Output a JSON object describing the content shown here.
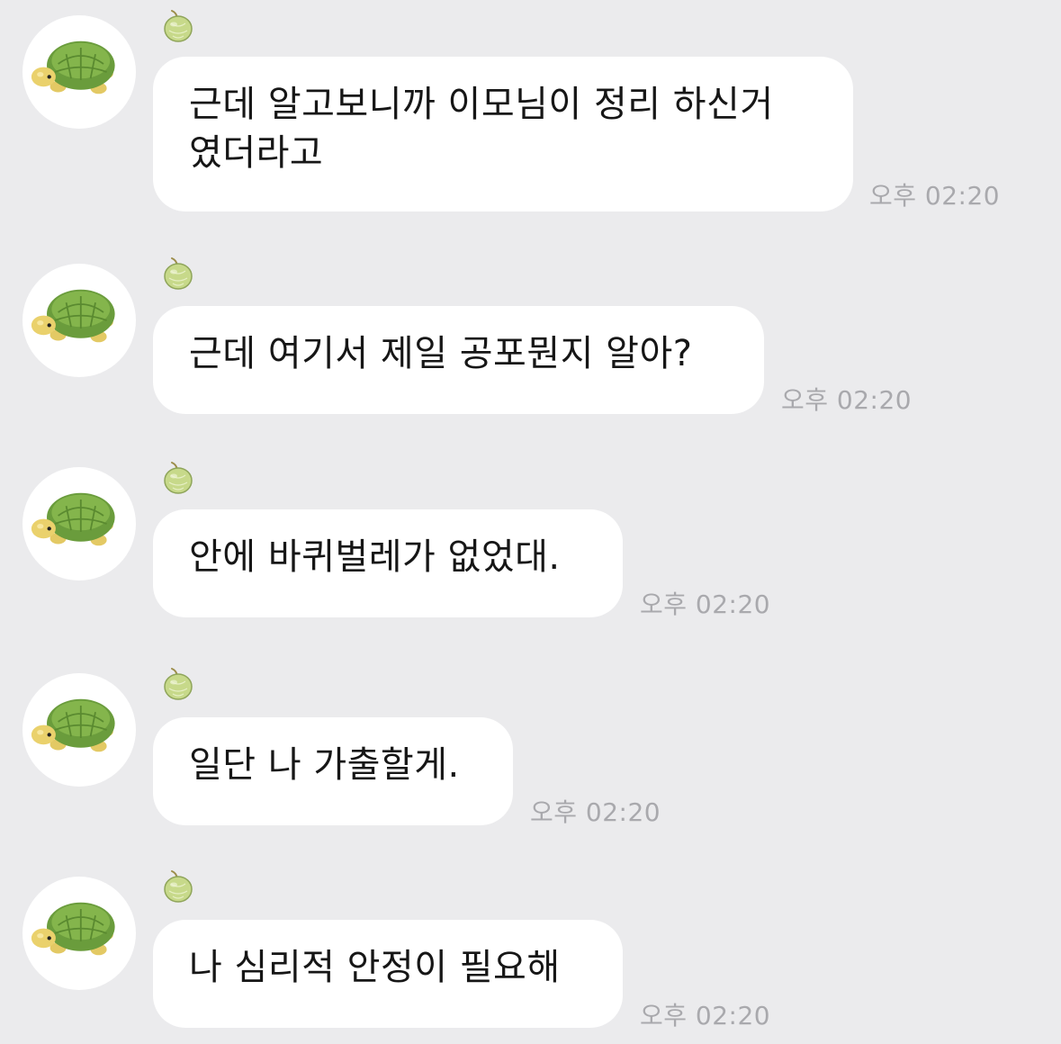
{
  "sender": {
    "avatar_icon": "turtle-avatar-icon",
    "name_icon": "melon-icon"
  },
  "colors": {
    "background": "#ebebed",
    "bubble": "#ffffff",
    "text": "#161616",
    "timestamp": "#a9a9ad",
    "turtle_shell": "#6e9e3e",
    "turtle_head": "#e8cf6a",
    "melon": "#c7d98a"
  },
  "messages": [
    {
      "text": "근데 알고보니까 이모님이 정리 하신거\n였더라고",
      "time": "오후 02:20"
    },
    {
      "text": "근데 여기서 제일 공포뭔지 알아?",
      "time": "오후 02:20"
    },
    {
      "text": "안에 바퀴벌레가 없었대.",
      "time": "오후 02:20"
    },
    {
      "text": "일단 나 가출할게.",
      "time": "오후 02:20"
    },
    {
      "text": "나 심리적 안정이 필요해",
      "time": "오후 02:20"
    }
  ]
}
